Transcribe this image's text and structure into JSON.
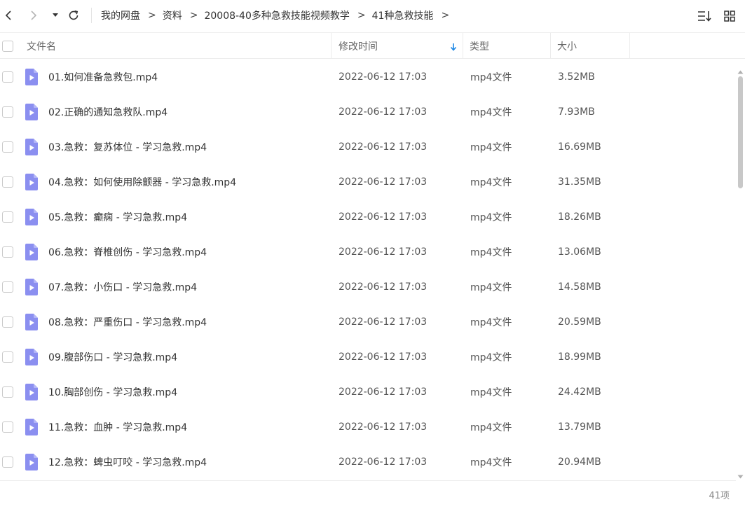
{
  "nav": {
    "back_icon": "chevron-left-icon",
    "forward_icon": "chevron-right-icon",
    "history_icon": "caret-down-icon",
    "refresh_icon": "refresh-icon",
    "breadcrumb": [
      "我的网盘",
      "资料",
      "20008-40多种急救技能视频教学",
      "41种急救技能"
    ],
    "separator": ">",
    "sort_icon": "sort-list-icon",
    "grid_icon": "grid-view-icon"
  },
  "columns": {
    "name": "文件名",
    "time": "修改时间",
    "type": "类型",
    "size": "大小",
    "sort_indicator": "arrow-down-icon"
  },
  "files": [
    {
      "name": "01.如何准备急救包.mp4",
      "time": "2022-06-12 17:03",
      "type": "mp4文件",
      "size": "3.52MB"
    },
    {
      "name": "02.正确的通知急救队.mp4",
      "time": "2022-06-12 17:03",
      "type": "mp4文件",
      "size": "7.93MB"
    },
    {
      "name": "03.急救：复苏体位 - 学习急救.mp4",
      "time": "2022-06-12 17:03",
      "type": "mp4文件",
      "size": "16.69MB"
    },
    {
      "name": "04.急救：如何使用除颤器 - 学习急救.mp4",
      "time": "2022-06-12 17:03",
      "type": "mp4文件",
      "size": "31.35MB"
    },
    {
      "name": "05.急救：癫痫 - 学习急救.mp4",
      "time": "2022-06-12 17:03",
      "type": "mp4文件",
      "size": "18.26MB"
    },
    {
      "name": "06.急救：脊椎创伤 - 学习急救.mp4",
      "time": "2022-06-12 17:03",
      "type": "mp4文件",
      "size": "13.06MB"
    },
    {
      "name": "07.急救：小伤口 - 学习急救.mp4",
      "time": "2022-06-12 17:03",
      "type": "mp4文件",
      "size": "14.58MB"
    },
    {
      "name": "08.急救：严重伤口 - 学习急救.mp4",
      "time": "2022-06-12 17:03",
      "type": "mp4文件",
      "size": "20.59MB"
    },
    {
      "name": "09.腹部伤口 - 学习急救.mp4",
      "time": "2022-06-12 17:03",
      "type": "mp4文件",
      "size": "18.99MB"
    },
    {
      "name": "10.胸部创伤 - 学习急救.mp4",
      "time": "2022-06-12 17:03",
      "type": "mp4文件",
      "size": "24.42MB"
    },
    {
      "name": "11.急救：血肿 - 学习急救.mp4",
      "time": "2022-06-12 17:03",
      "type": "mp4文件",
      "size": "13.79MB"
    },
    {
      "name": "12.急救：蜱虫叮咬 - 学习急救.mp4",
      "time": "2022-06-12 17:03",
      "type": "mp4文件",
      "size": "20.94MB"
    }
  ],
  "file_icon": "video-file-icon",
  "colors": {
    "video_icon": "#8b8ff0",
    "sort_arrow": "#1e88e5"
  },
  "footer": {
    "count": "41项"
  }
}
